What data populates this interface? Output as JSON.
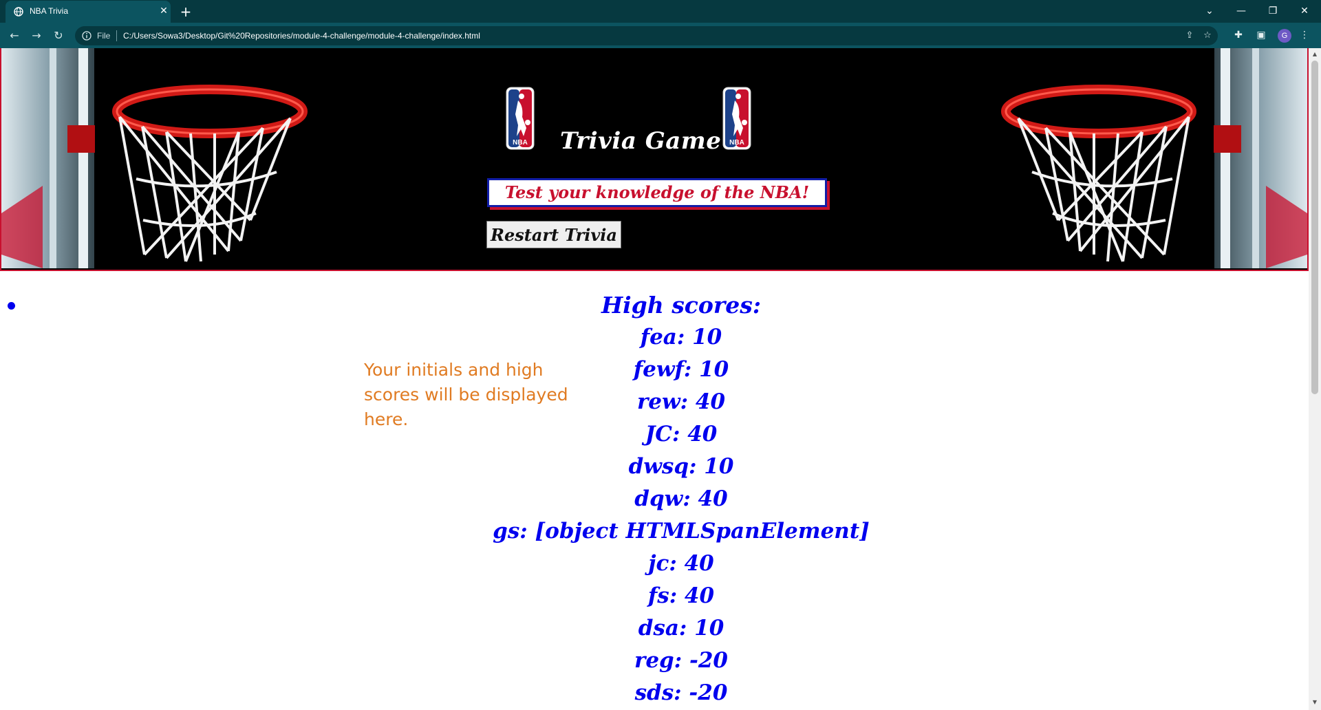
{
  "browser": {
    "tab_title": "NBA Trivia",
    "tab_close": "✕",
    "new_tab": "+",
    "url_scheme": "File",
    "url": "C:/Users/Sowa3/Desktop/Git%20Repositories/module-4-challenge/module-4-challenge/index.html",
    "profile_initial": "G"
  },
  "header": {
    "title": "Trivia Game",
    "tagline": "Test your knowledge of the NBA!",
    "restart_label": "Restart Trivia",
    "logo_text": "NBA"
  },
  "hint": "Your initials and high scores will be displayed here.",
  "scores": {
    "heading": "High scores:",
    "entries": [
      "fea: 10",
      "fewf: 10",
      "rew: 40",
      "JC: 40",
      "dwsq: 10",
      "dqw: 40",
      "gs: [object HTMLSpanElement]",
      "jc: 40",
      "fs: 40",
      "dsa: 10",
      "reg: -20",
      "sds: -20"
    ]
  },
  "colors": {
    "accent_red": "#c8102e",
    "accent_blue": "#111ea8",
    "score_blue": "#0000ee",
    "hint_orange": "#e07b22",
    "chrome_dark": "#063940",
    "chrome": "#0c5460"
  }
}
